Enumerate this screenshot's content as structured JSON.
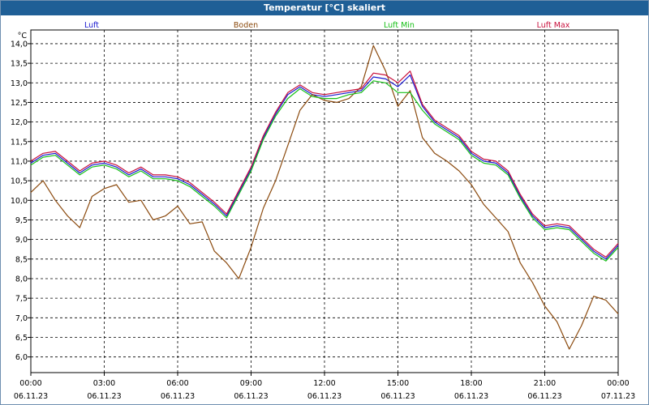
{
  "window": {
    "title": "Temperatur [°C] skaliert"
  },
  "chart_data": {
    "type": "line",
    "title": "Temperatur [°C] skaliert",
    "ylabel": "°C",
    "ylim": [
      5.6,
      14.35
    ],
    "xlim": [
      "06.11.23 00:00",
      "07.11.23 00:00"
    ],
    "grid": true,
    "legend_placement": "top",
    "y_ticks": [
      "6,0",
      "6,5",
      "7,0",
      "7,5",
      "8,0",
      "8,5",
      "9,0",
      "9,5",
      "10,0",
      "10,5",
      "11,0",
      "11,5",
      "12,0",
      "12,5",
      "13,0",
      "13,5",
      "14,0"
    ],
    "x_ticks": [
      {
        "time": "00:00",
        "date": "06.11.23"
      },
      {
        "time": "03:00",
        "date": "06.11.23"
      },
      {
        "time": "06:00",
        "date": "06.11.23"
      },
      {
        "time": "09:00",
        "date": "06.11.23"
      },
      {
        "time": "12:00",
        "date": "06.11.23"
      },
      {
        "time": "15:00",
        "date": "06.11.23"
      },
      {
        "time": "18:00",
        "date": "06.11.23"
      },
      {
        "time": "21:00",
        "date": "06.11.23"
      },
      {
        "time": "00:00",
        "date": "07.11.23"
      }
    ],
    "x": [
      0,
      0.5,
      1,
      1.5,
      2,
      2.5,
      3,
      3.5,
      4,
      4.5,
      5,
      5.5,
      6,
      6.5,
      7,
      7.5,
      8,
      8.5,
      9,
      9.5,
      10,
      10.5,
      11,
      11.5,
      12,
      12.5,
      13,
      13.5,
      14,
      14.5,
      15,
      15.5,
      16,
      16.5,
      17,
      17.5,
      18,
      18.5,
      19,
      19.5,
      20,
      20.5,
      21,
      21.5,
      22,
      22.5,
      23,
      23.5,
      24
    ],
    "series": [
      {
        "name": "Luft",
        "color": "#1a1ad0",
        "values": [
          10.95,
          11.15,
          11.2,
          10.95,
          10.7,
          10.9,
          10.95,
          10.85,
          10.65,
          10.8,
          10.6,
          10.6,
          10.55,
          10.4,
          10.15,
          9.9,
          9.6,
          10.2,
          10.8,
          11.6,
          12.2,
          12.7,
          12.9,
          12.7,
          12.65,
          12.7,
          12.75,
          12.8,
          13.15,
          13.1,
          12.9,
          13.2,
          12.4,
          12.0,
          11.8,
          11.6,
          11.2,
          11.0,
          10.95,
          10.7,
          10.1,
          9.6,
          9.3,
          9.35,
          9.3,
          9.0,
          8.7,
          8.5,
          8.85
        ]
      },
      {
        "name": "Boden",
        "color": "#8b4a0e",
        "values": [
          10.2,
          10.5,
          10.0,
          9.6,
          9.3,
          10.1,
          10.3,
          10.4,
          9.95,
          10.0,
          9.5,
          9.6,
          9.85,
          9.4,
          9.45,
          8.7,
          8.4,
          8.0,
          8.8,
          9.8,
          10.5,
          11.4,
          12.3,
          12.7,
          12.55,
          12.5,
          12.6,
          12.9,
          13.95,
          13.3,
          12.4,
          12.8,
          11.6,
          11.2,
          11.0,
          10.75,
          10.4,
          9.9,
          9.55,
          9.2,
          8.4,
          7.9,
          7.3,
          6.9,
          6.2,
          6.8,
          7.55,
          7.45,
          7.1
        ]
      },
      {
        "name": "Luft Min",
        "color": "#18c018",
        "values": [
          10.9,
          11.1,
          11.15,
          10.9,
          10.65,
          10.85,
          10.9,
          10.8,
          10.6,
          10.75,
          10.55,
          10.55,
          10.5,
          10.35,
          10.1,
          9.85,
          9.55,
          10.15,
          10.75,
          11.55,
          12.15,
          12.6,
          12.85,
          12.65,
          12.6,
          12.6,
          12.7,
          12.75,
          13.05,
          13.0,
          12.75,
          12.75,
          12.3,
          11.95,
          11.75,
          11.55,
          11.15,
          10.95,
          10.9,
          10.65,
          10.05,
          9.55,
          9.25,
          9.3,
          9.25,
          8.95,
          8.65,
          8.45,
          8.8
        ]
      },
      {
        "name": "Luft Max",
        "color": "#c8103c",
        "values": [
          11.0,
          11.2,
          11.25,
          11.0,
          10.75,
          10.95,
          11.0,
          10.9,
          10.7,
          10.85,
          10.65,
          10.65,
          10.6,
          10.45,
          10.2,
          9.95,
          9.65,
          10.25,
          10.85,
          11.65,
          12.25,
          12.75,
          12.95,
          12.75,
          12.7,
          12.75,
          12.8,
          12.85,
          13.25,
          13.2,
          13.0,
          13.3,
          12.45,
          12.05,
          11.85,
          11.65,
          11.25,
          11.05,
          11.0,
          10.75,
          10.15,
          9.65,
          9.35,
          9.4,
          9.35,
          9.05,
          8.75,
          8.55,
          8.9
        ]
      }
    ]
  }
}
